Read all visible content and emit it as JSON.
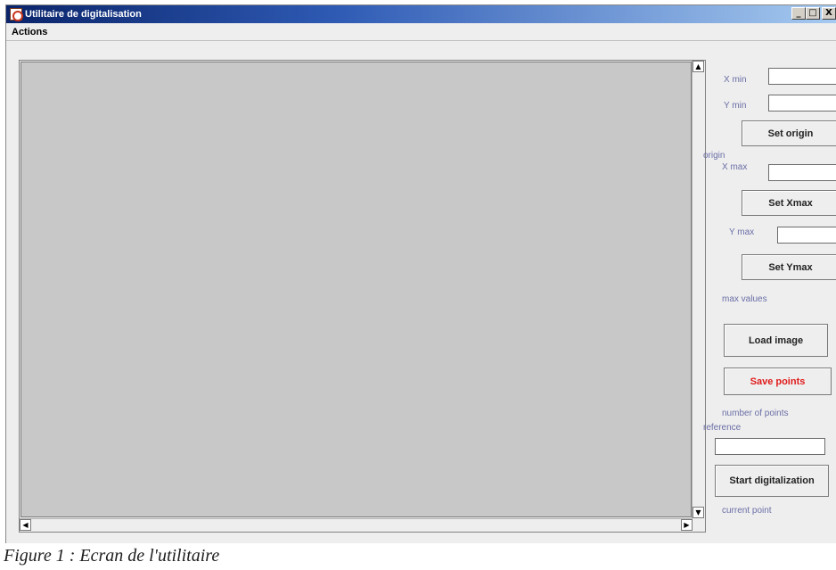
{
  "window": {
    "title": "Utilitaire de digitalisation",
    "controls": {
      "minimize": "_",
      "maximize": "□",
      "close": "X"
    },
    "icon": "app-icon"
  },
  "menu": {
    "actions_label": "Actions"
  },
  "scrollbar": {
    "up": "▲",
    "down": "▼",
    "left": "◀",
    "right": "▶"
  },
  "panel": {
    "xmin_label": "X min",
    "xmin_value": "",
    "ymin_label": "Y min",
    "ymin_value": "",
    "set_origin_label": "Set origin",
    "origin_label": "origin",
    "xmax_label": "X max",
    "xmax_value": "",
    "set_xmax_label": "Set Xmax",
    "ymax_label": "Y max",
    "ymax_value": "",
    "set_ymax_label": "Set Ymax",
    "max_values_label": "max values",
    "load_image_label": "Load image",
    "save_points_label": "Save points",
    "number_of_points_label": "number of points",
    "reference_label": "reference",
    "reference_value": "",
    "start_digitalization_label": "Start digitalization",
    "current_point_label": "current point"
  },
  "caption": "Figure 1 : Ecran de l'utilitaire",
  "colors": {
    "label_text": "#6a6ea6",
    "save_button_text": "#e01b1b",
    "titlebar_start": "#0a246a",
    "titlebar_end": "#a6caf0",
    "canvas_bg": "#c8c8c8"
  }
}
